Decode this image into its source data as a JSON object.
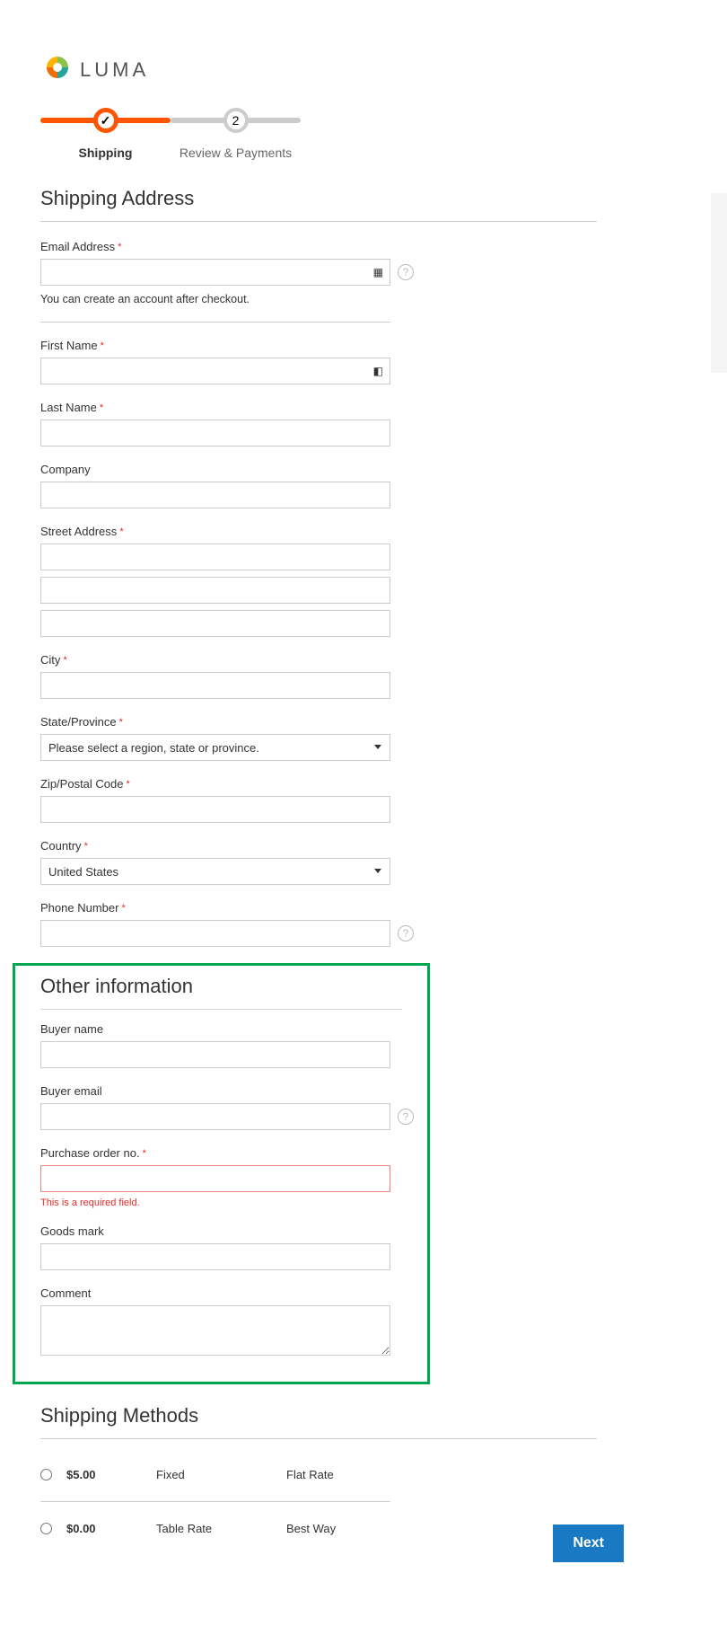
{
  "brand": {
    "name": "LUMA"
  },
  "progress": {
    "step1": {
      "label": "Shipping",
      "icon": "✓"
    },
    "step2": {
      "label": "Review & Payments",
      "num": "2"
    }
  },
  "sections": {
    "shipping_address": "Shipping Address",
    "other_info": "Other information",
    "shipping_methods": "Shipping Methods"
  },
  "fields": {
    "email": {
      "label": "Email Address",
      "value": "",
      "hint": "You can create an account after checkout."
    },
    "first_name": {
      "label": "First Name",
      "value": ""
    },
    "last_name": {
      "label": "Last Name",
      "value": ""
    },
    "company": {
      "label": "Company",
      "value": ""
    },
    "street": {
      "label": "Street Address",
      "values": [
        "",
        "",
        ""
      ]
    },
    "city": {
      "label": "City",
      "value": ""
    },
    "state": {
      "label": "State/Province",
      "placeholder": "Please select a region, state or province."
    },
    "zip": {
      "label": "Zip/Postal Code",
      "value": ""
    },
    "country": {
      "label": "Country",
      "value": "United States"
    },
    "phone": {
      "label": "Phone Number",
      "value": ""
    },
    "buyer_name": {
      "label": "Buyer name",
      "value": ""
    },
    "buyer_email": {
      "label": "Buyer email",
      "value": ""
    },
    "po_no": {
      "label": "Purchase order no.",
      "value": "",
      "error": "This is a required field."
    },
    "goods_mark": {
      "label": "Goods mark",
      "value": ""
    },
    "comment": {
      "label": "Comment",
      "value": ""
    }
  },
  "shipping_methods": [
    {
      "price": "$5.00",
      "type": "Fixed",
      "carrier": "Flat Rate"
    },
    {
      "price": "$0.00",
      "type": "Table Rate",
      "carrier": "Best Way"
    }
  ],
  "buttons": {
    "next": "Next"
  }
}
